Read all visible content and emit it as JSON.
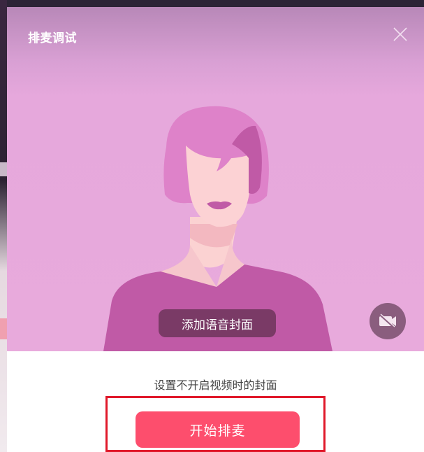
{
  "dialog": {
    "title": "排麦调试",
    "close_icon": "close-icon"
  },
  "preview": {
    "cover_button_label": "添加语音封面",
    "camera_icon": "camera-off-icon"
  },
  "footer": {
    "caption": "设置不开启视频时的封面",
    "start_button_label": "开始排麦"
  },
  "colors": {
    "preview_background": "#e8aadc",
    "start_button": "#fd4e6d",
    "highlight_border": "#e0182a",
    "cover_button": "#7a3a66"
  }
}
